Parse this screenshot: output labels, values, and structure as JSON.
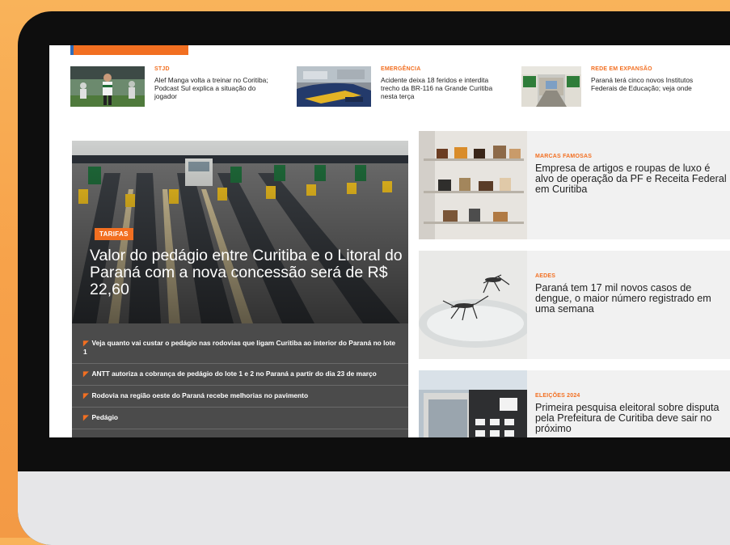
{
  "top_strip": [
    {
      "tag": "STJD",
      "title": "Alef Manga volta a treinar no Coritiba; Podcast Sul explica a situação do jogador"
    },
    {
      "tag": "EMERGÊNCIA",
      "title": "Acidente deixa 18 feridos e interdita trecho da BR-116 na Grande Curitiba nesta terça"
    },
    {
      "tag": "REDE EM EXPANSÃO",
      "title": "Paraná terá cinco novos Institutos Federais de Educação; veja onde"
    }
  ],
  "hero": {
    "tag": "TARIFAS",
    "title": "Valor do pedágio entre Curitiba e o Litoral do Paraná com a nova concessão será de R$ 22,60",
    "related": [
      "Veja quanto vai custar o pedágio nas rodovias que ligam Curitiba ao interior do Paraná no lote 1",
      "ANTT autoriza a cobrança de pedágio do lote 1 e 2 no Paraná a partir do dia 23 de março",
      "Rodovia na região oeste do Paraná recebe melhorias no pavimento",
      "Pedágio"
    ]
  },
  "side_cards": [
    {
      "tag": "MARCAS FAMOSAS",
      "title": "Empresa de artigos e roupas de luxo é alvo de operação da PF e Receita Federal em Curitiba"
    },
    {
      "tag": "AEDES",
      "title": "Paraná tem 17 mil novos casos de dengue, o maior número registrado em uma semana"
    },
    {
      "tag": "ELEIÇÕES 2024",
      "title": "Primeira pesquisa eleitoral sobre disputa pela Prefeitura de Curitiba deve sair no próximo"
    }
  ],
  "colors": {
    "accent": "#f26f21",
    "frame": "#0e0e0e",
    "background": "#f7a24a"
  }
}
